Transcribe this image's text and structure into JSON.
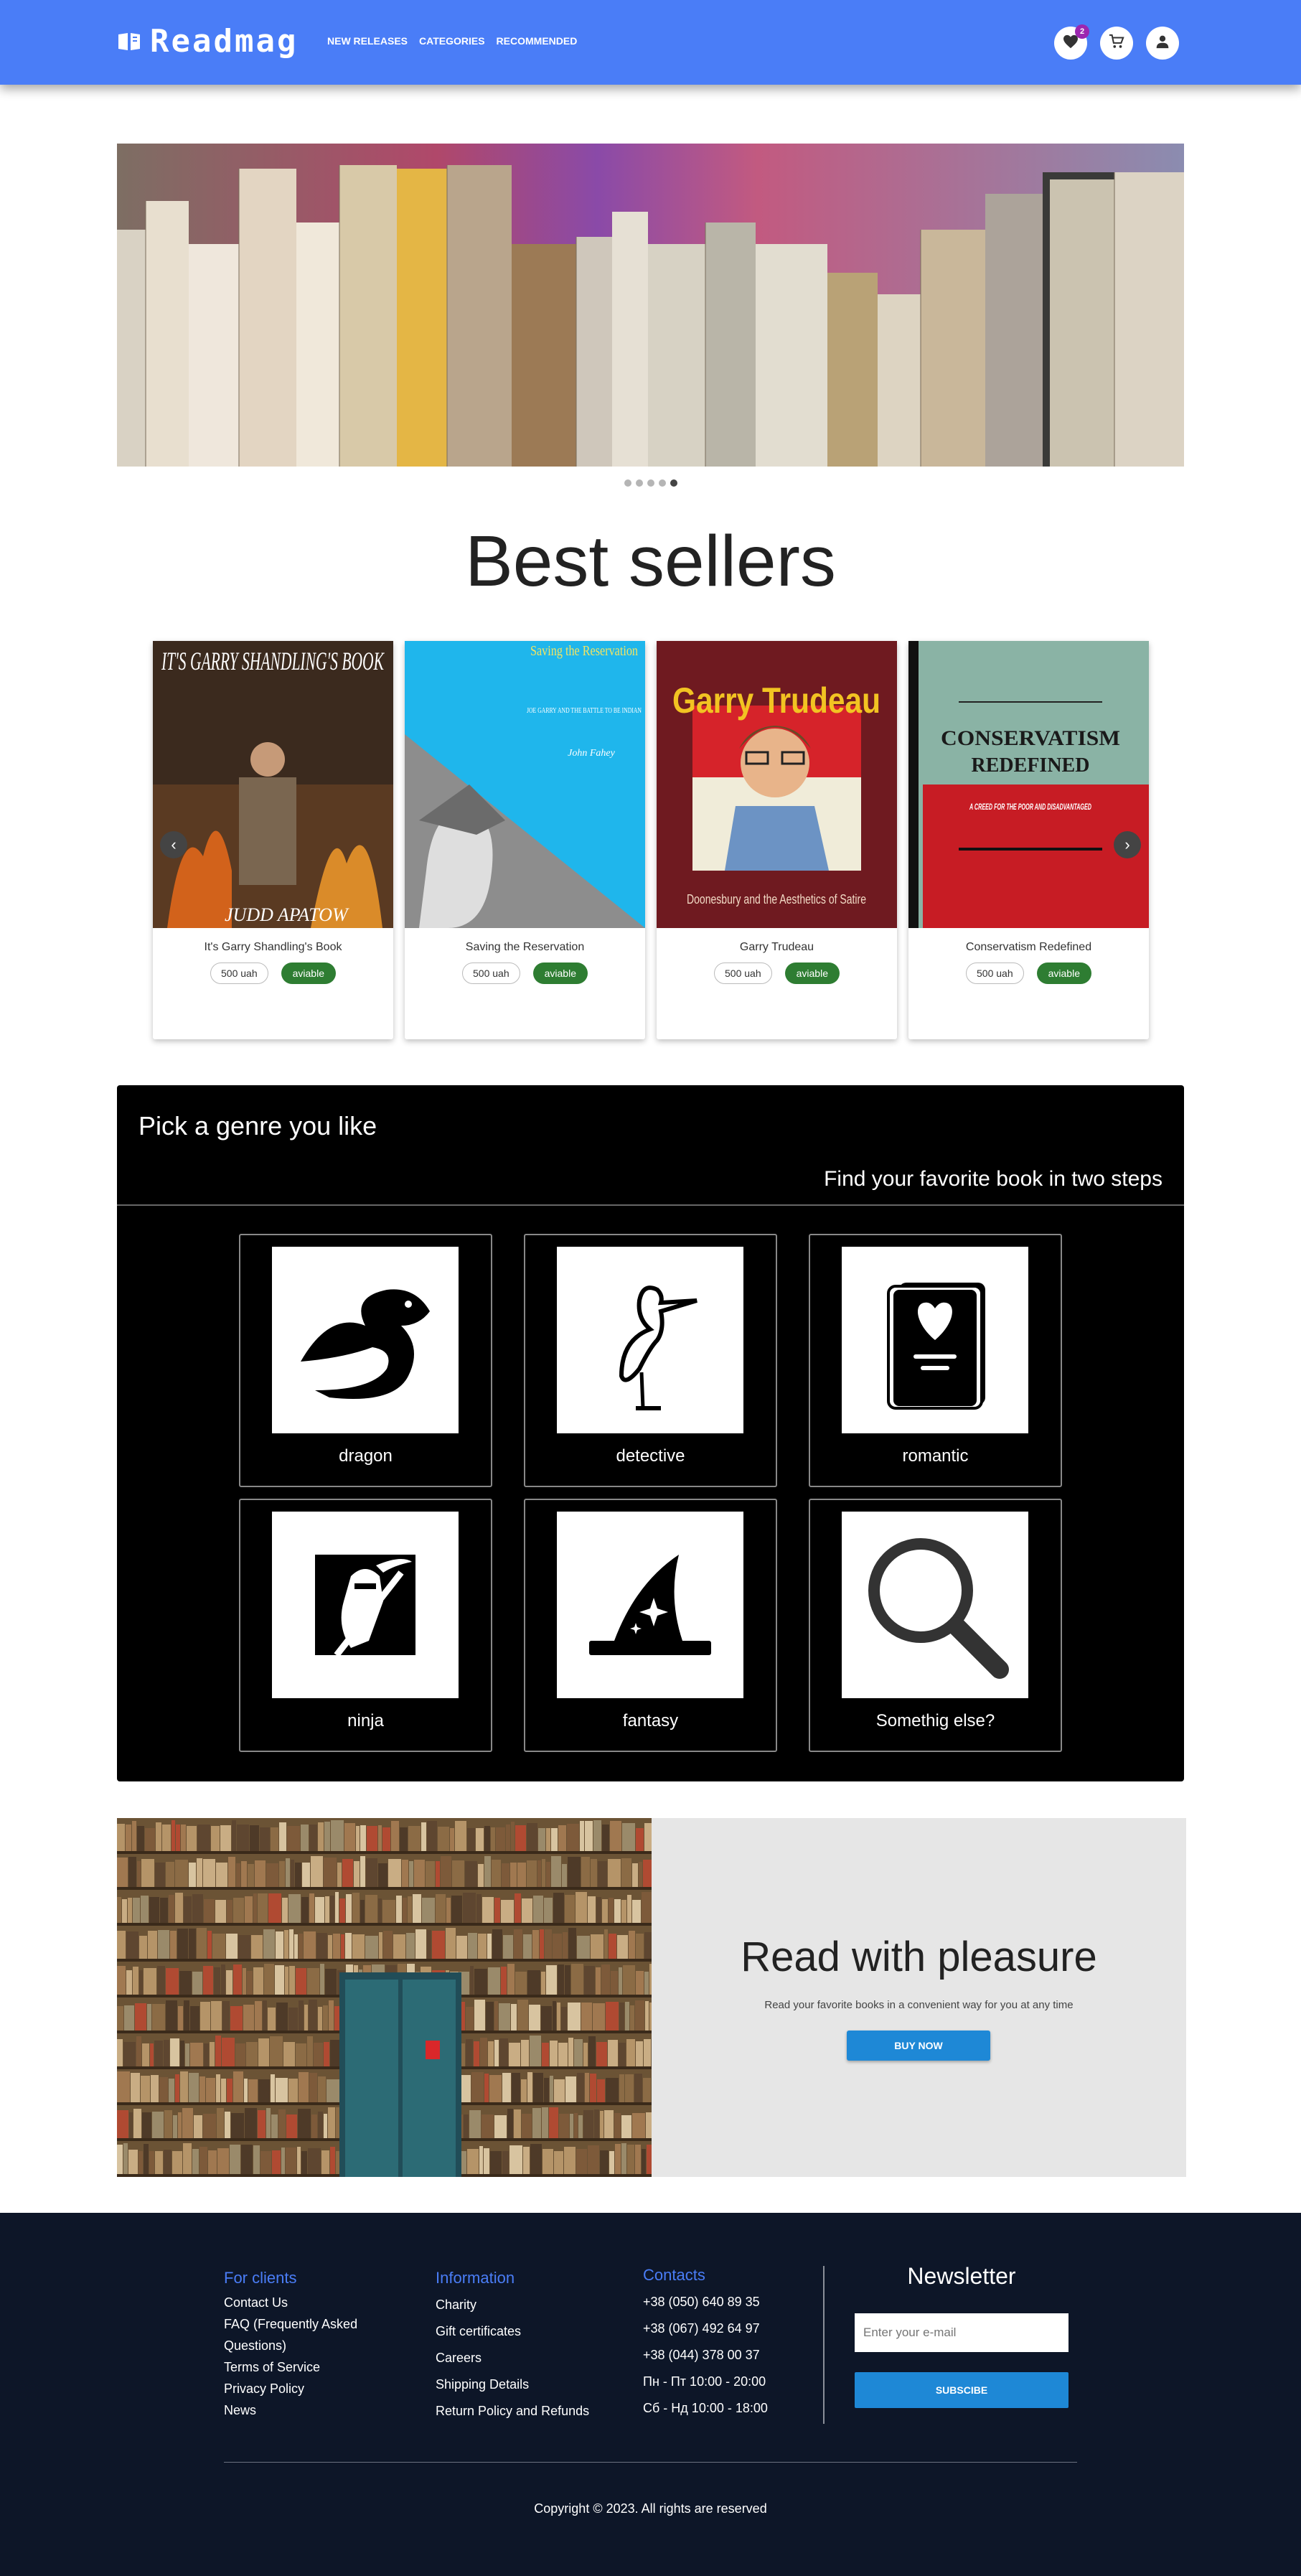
{
  "header": {
    "logo": "Readmag",
    "nav": [
      "NEW RELEASES",
      "CATEGORIES",
      "RECOMMENDED"
    ],
    "wishlist_count": "2",
    "icons": [
      "heart-icon",
      "cart-icon",
      "user-icon"
    ],
    "accent_color": "#4a7df7"
  },
  "hero": {
    "slides_count": 5,
    "active_slide": 5
  },
  "bestsellers": {
    "title": "Best sellers",
    "books": [
      {
        "name": "It's Garry Shandling's Book",
        "price": "500 uah",
        "status": "aviable"
      },
      {
        "name": "Saving the Reservation",
        "price": "500 uah",
        "status": "aviable"
      },
      {
        "name": "Garry Trudeau",
        "price": "500 uah",
        "status": "aviable"
      },
      {
        "name": "Conservatism Redefined",
        "price": "500 uah",
        "status": "aviable"
      }
    ],
    "covers": {
      "book1_title": "IT'S GARRY SHANDLING'S BOOK",
      "book1_author": "JUDD APATOW",
      "book2_title": "Saving the Reservation",
      "book2_subtitle": "JOE GARRY AND THE BATTLE TO BE INDIAN",
      "book2_author": "John Fahey",
      "book3_title": "Garry Trudeau",
      "book3_subtitle": "Doonesbury and the Aesthetics of Satire",
      "book4_title": "CONSERVATISM",
      "book4_title2": "REDEFINED",
      "book4_subtitle": "A CREED FOR THE POOR AND DISADVANTAGED"
    }
  },
  "genres": {
    "title": "Pick a genre you like",
    "subtitle": "Find your favorite book in two steps",
    "items": [
      {
        "label": "dragon",
        "icon": "dragon-icon"
      },
      {
        "label": "detective",
        "icon": "heron-icon"
      },
      {
        "label": "romantic",
        "icon": "love-book-icon"
      },
      {
        "label": "ninja",
        "icon": "ninja-icon"
      },
      {
        "label": "fantasy",
        "icon": "wizard-hat-icon"
      },
      {
        "label": "Somethig else?",
        "icon": "magnifier-icon"
      }
    ]
  },
  "promo": {
    "title": "Read with pleasure",
    "text": "Read your favorite books in a convenient way for you at any time",
    "button": "BUY NOW"
  },
  "footer": {
    "clients": {
      "heading": "For clients",
      "items": [
        "Contact Us",
        "FAQ (Frequently Asked",
        "Questions)",
        "Terms of Service",
        "Privacy Policy",
        "News"
      ]
    },
    "information": {
      "heading": "Information",
      "items": [
        "Charity",
        "Gift certificates",
        "Careers",
        "Shipping Details",
        "Return Policy and Refunds"
      ]
    },
    "contacts": {
      "heading": "Contacts",
      "items": [
        "+38 (050) 640 89 35",
        "+38 (067) 492 64 97",
        "+38 (044) 378 00 37",
        "Пн - Пт 10:00 - 20:00",
        "Сб - Нд 10:00 - 18:00"
      ]
    },
    "newsletter": {
      "title": "Newsletter",
      "placeholder": "Enter your e-mail",
      "button": "SUBSCIBE"
    },
    "copyright": "Copyright © 2023. All rights are reserved"
  }
}
